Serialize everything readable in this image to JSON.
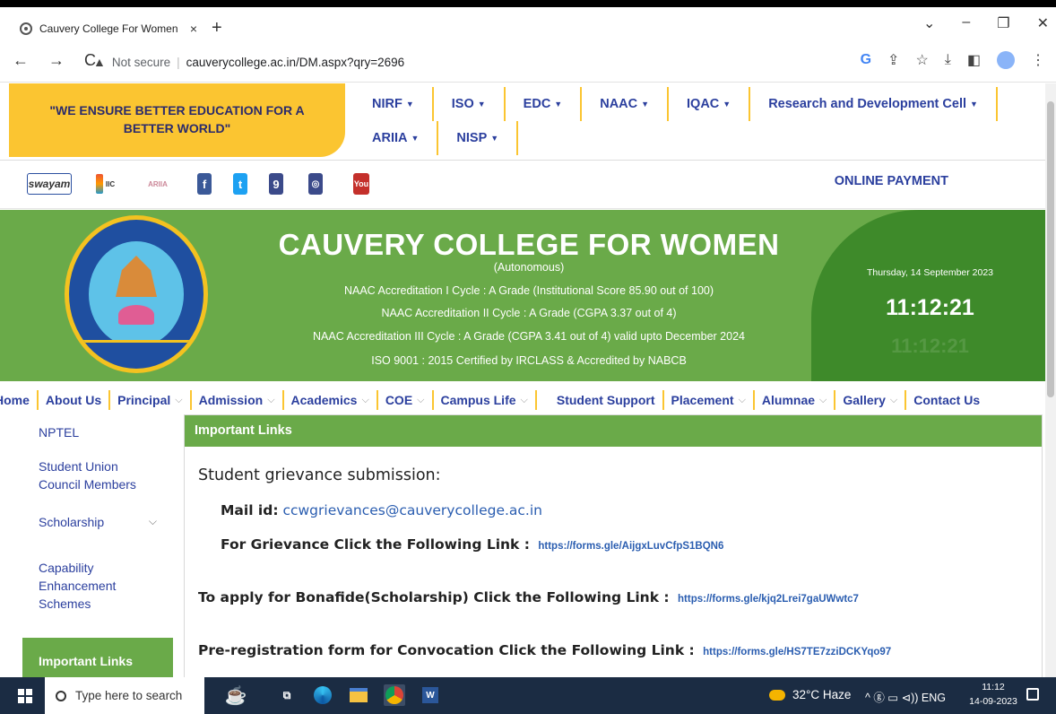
{
  "browser": {
    "tab_title": "Cauvery College For Women",
    "tab_close": "×",
    "new_tab": "+",
    "win_controls": [
      "⌄",
      "–",
      "❐",
      "✕"
    ],
    "nav": [
      "←",
      "→",
      "C"
    ],
    "not_secure": "Not secure",
    "url": "cauverycollege.ac.in/DM.aspx?qry=2696",
    "right_icons": [
      "G",
      "⇪",
      "☆",
      "⤓",
      "◧"
    ]
  },
  "header": {
    "slogan": "\"WE ENSURE BETTER EDUCATION FOR A BETTER WORLD\"",
    "top_menu_row1": [
      "NIRF",
      "ISO",
      "EDC",
      "NAAC",
      "IQAC",
      "Research and Development Cell"
    ],
    "top_menu_row2": [
      "ARIIA",
      "NISP"
    ],
    "online_payment": "ONLINE PAYMENT",
    "social": {
      "swayam": "swayam",
      "facebook": "f",
      "twitter": "t",
      "location": "9",
      "instagram": "◎",
      "youtube": "You"
    }
  },
  "banner": {
    "title": "CAUVERY COLLEGE FOR WOMEN",
    "subtitle": "(Autonomous)",
    "accreditations": [
      "NAAC Accreditation I Cycle : A Grade (Institutional Score 85.90 out of 100)",
      "NAAC Accreditation II Cycle : A Grade (CGPA 3.37 out of 4)",
      "NAAC Accreditation III Cycle : A Grade (CGPA 3.41 out of 4) valid upto December 2024",
      "ISO 9001 : 2015 Certified by IRCLASS & Accredited by NABCB"
    ],
    "date": "Thursday, 14 September 2023",
    "time": "11:12:21"
  },
  "main_nav": [
    "Home",
    "About Us",
    "Principal",
    "Admission",
    "Academics",
    "COE",
    "Campus Life",
    "Student Support",
    "Placement",
    "Alumnae",
    "Gallery",
    "Contact Us"
  ],
  "sidebar": {
    "items": [
      "NPTEL",
      "Student Union Council Members",
      "Scholarship",
      "Capability Enhancement Schemes",
      "Important Links"
    ]
  },
  "content": {
    "heading": "Important Links",
    "grievance_title": "Student grievance submission:",
    "mail_label": "Mail id:",
    "mail_value": "ccwgrievances@cauverycollege.ac.in",
    "grievance_text": "For Grievance Click the Following Link :",
    "grievance_url": "https://forms.gle/AijgxLuvCfpS1BQN6",
    "bonafide_text": "To apply for Bonafide(Scholarship) Click the Following Link :",
    "bonafide_url": "https://forms.gle/kjq2Lrei7gaUWwtc7",
    "convocation_text": "Pre-registration form for Convocation Click the Following Link :",
    "convocation_url": "https://forms.gle/HS7TE7zziDCKYqo97"
  },
  "taskbar": {
    "search_placeholder": "Type here to search",
    "weather": "32°C  Haze",
    "tray": "^  ⓖ  ▭  ⊲))  ENG",
    "clock_time": "11:12",
    "clock_date": "14-09-2023"
  },
  "colors": {
    "brand_green": "#6aaa49",
    "slogan_yellow": "#fbc531",
    "menu_blue": "#2b3f9e",
    "link_blue": "#2a5db0"
  }
}
